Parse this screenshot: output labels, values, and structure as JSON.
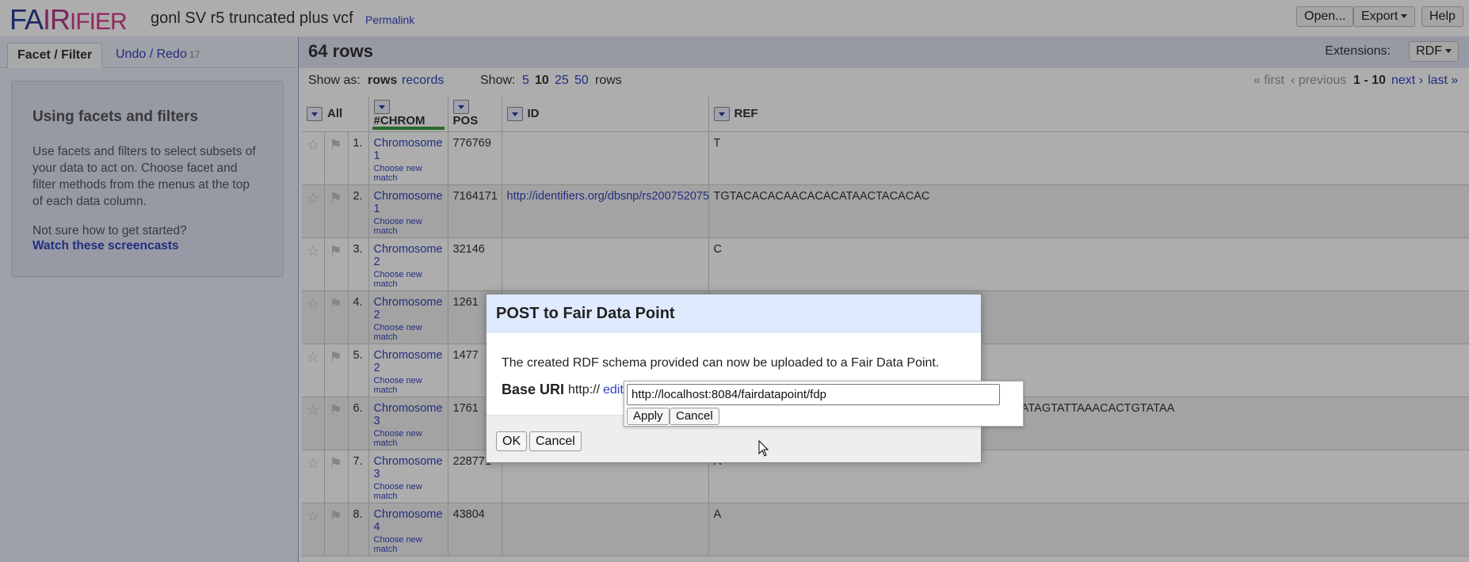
{
  "header": {
    "logo": {
      "part1": "FA",
      "part2": "IR",
      "part3": "IFIER"
    },
    "project_title": "gonl SV r5 truncated plus vcf",
    "permalink": "Permalink",
    "open_label": "Open...",
    "export_label": "Export",
    "help_label": "Help"
  },
  "left_panel": {
    "tabs": [
      {
        "label": "Facet / Filter"
      },
      {
        "label": "Undo / Redo",
        "count": "17"
      }
    ],
    "help": {
      "title": "Using facets and filters",
      "body": "Use facets and filters to select subsets of your data to act on. Choose facet and filter methods from the menus at the top of each data column.",
      "question": "Not sure how to get started?",
      "link": "Watch these screencasts"
    }
  },
  "summary": {
    "row_count": "64 rows",
    "extensions_label": "Extensions:",
    "extensions_value": "RDF"
  },
  "view": {
    "show_as_label": "Show as:",
    "mode_rows": "rows",
    "mode_records": "records",
    "show_label": "Show:",
    "page_sizes": [
      "5",
      "10",
      "25",
      "50"
    ],
    "page_sizes_unit": "rows",
    "pager": {
      "first": "« first",
      "previous": "‹ previous",
      "range": "1 - 10",
      "next": "next ›",
      "last": "last »"
    }
  },
  "table": {
    "columns": [
      "All",
      "#CHROM",
      "POS",
      "ID",
      "REF"
    ],
    "match_text": "Choose new match",
    "rows": [
      {
        "num": "1.",
        "chrom": "Chromosome 1",
        "pos": "776769",
        "id": "",
        "ref": "T"
      },
      {
        "num": "2.",
        "chrom": "Chromosome 1",
        "pos": "7164171",
        "id": "http://identifiers.org/dbsnp/rs200752075",
        "ref": "TGTACACACAACACACATAACTACACAC"
      },
      {
        "num": "3.",
        "chrom": "Chromosome 2",
        "pos": "32146",
        "id": "",
        "ref": "C"
      },
      {
        "num": "4.",
        "chrom": "Chromosome 2",
        "pos": "1261",
        "id": "",
        "ref": ""
      },
      {
        "num": "5.",
        "chrom": "Chromosome 2",
        "pos": "1477",
        "id": "",
        "ref": ""
      },
      {
        "num": "6.",
        "chrom": "Chromosome 3",
        "pos": "1761",
        "id": "",
        "ref": "TGTATAAAATGGATATAGTATTAAACACTGTATATACTGGATATAGTATTAAACACTGTATAA"
      },
      {
        "num": "7.",
        "chrom": "Chromosome 3",
        "pos": "228771",
        "id": "",
        "ref": "A"
      },
      {
        "num": "8.",
        "chrom": "Chromosome 4",
        "pos": "43804",
        "id": "",
        "ref": "A"
      }
    ]
  },
  "dialog": {
    "title": "POST to Fair Data Point",
    "text": "The created RDF schema provided can now be uploaded to a Fair Data Point.",
    "base_uri_label": "Base URI",
    "base_uri_prefix": "http://",
    "edit_label": "edit",
    "base_uri_value": "http://localhost:8084/fairdatapoint/fdp",
    "apply_label": "Apply",
    "popup_cancel_label": "Cancel",
    "ok_label": "OK",
    "cancel_label": "Cancel"
  }
}
